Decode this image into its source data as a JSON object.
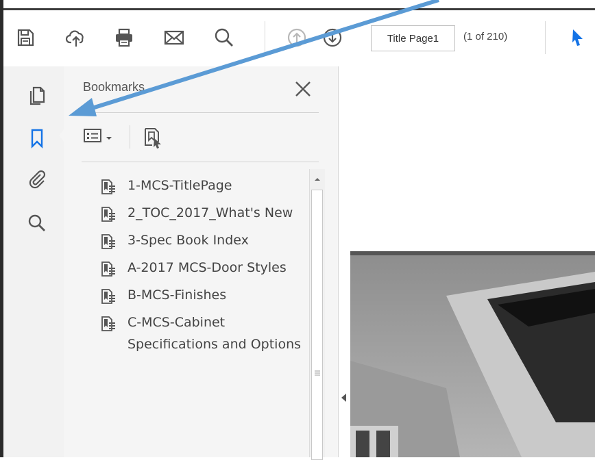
{
  "toolbar": {
    "icons": [
      "save-icon",
      "upload-cloud-icon",
      "print-icon",
      "email-icon",
      "search-icon",
      "previous-page-icon",
      "next-page-icon",
      "select-tool-icon"
    ],
    "page_field_value": "Title Page1",
    "page_count": "(1 of 210)"
  },
  "rail": {
    "icons": [
      "page-thumbnails-icon",
      "bookmarks-icon",
      "attachments-icon",
      "search-icon"
    ]
  },
  "bookmarks_panel": {
    "title": "Bookmarks",
    "items": [
      {
        "label": "1-MCS-TitlePage"
      },
      {
        "label": "2_TOC_2017_What's New"
      },
      {
        "label": "3-Spec Book Index"
      },
      {
        "label": "A-2017 MCS-Door Styles"
      },
      {
        "label": "B-MCS-Finishes"
      },
      {
        "label": "C-MCS-Cabinet Specifications and Options"
      }
    ]
  },
  "colors": {
    "accent_blue": "#1473e6",
    "annotation_arrow": "#5b9bd5",
    "icon_gray": "#555555"
  }
}
